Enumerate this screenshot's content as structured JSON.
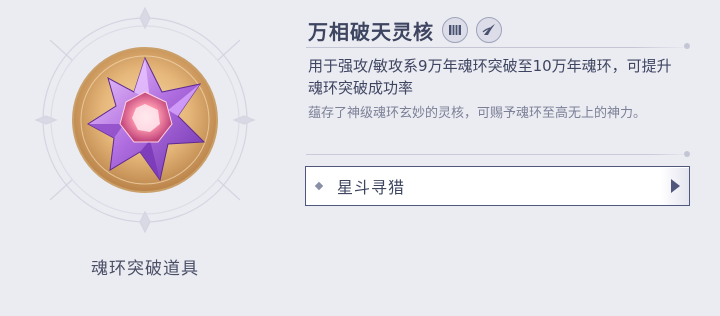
{
  "item": {
    "name": "万相破天灵核",
    "type_label": "魂环突破道具",
    "effect": "用于强攻/敏攻系9万年魂环突破至10万年魂环，可提升魂环突破成功率",
    "flavor": "蕴存了神级魂环玄妙的灵核，可赐予魂环至高无上的神力。",
    "badges": [
      {
        "icon": "attack-class-icon"
      },
      {
        "icon": "agility-class-icon"
      }
    ]
  },
  "source": {
    "label": "星斗寻猎",
    "icon": "diamond-bullet-icon",
    "arrow_icon": "play-arrow-icon"
  },
  "colors": {
    "background": "#ebebf2",
    "text_primary": "#3e4560",
    "text_secondary": "#7b8096",
    "button_border": "#4f577d",
    "orb_gold": "#c9995a",
    "crystal_purple": "#9a5cc8"
  }
}
